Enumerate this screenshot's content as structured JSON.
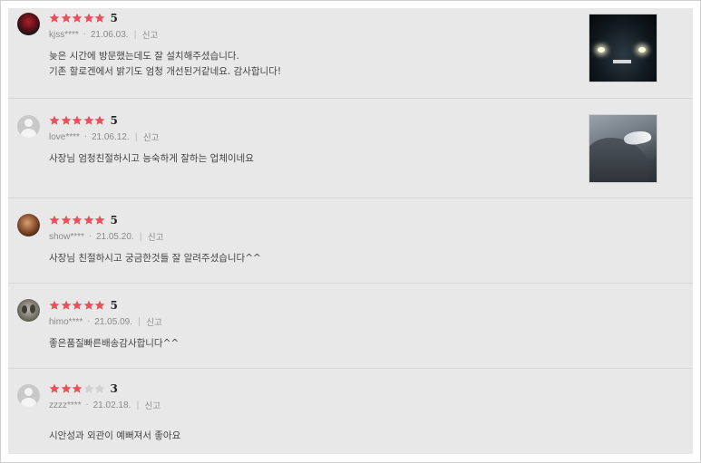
{
  "reviews": [
    {
      "avatar": "avatar-red-dark-photo",
      "stars": 5,
      "score": "5",
      "user": "kjss****",
      "date": "21.06.03.",
      "report": "신고",
      "lines": [
        "늦은 시간에 방문했는데도 잘 설치해주셨습니다.",
        "기존 할로겐에서 밝기도 엄청 개선된거같네요. 감사합니다!"
      ],
      "photo": "car-headlights-night-photo"
    },
    {
      "avatar": "default-user-icon",
      "stars": 5,
      "score": "5",
      "user": "love****",
      "date": "21.06.12.",
      "report": "신고",
      "lines": [
        "사장님 엄청친절하시고 능숙하게 잘하는 업체이네요"
      ],
      "photo": "car-headlight-closeup-photo"
    },
    {
      "avatar": "avatar-brown-photo",
      "stars": 5,
      "score": "5",
      "user": "show****",
      "date": "21.05.20.",
      "report": "신고",
      "lines": [
        "사장님 친절하시고 궁금한것들 잘 알려주셨습니다^^"
      ]
    },
    {
      "avatar": "avatar-people-photo",
      "stars": 5,
      "score": "5",
      "user": "himo****",
      "date": "21.05.09.",
      "report": "신고",
      "lines": [
        "좋은품질빠른배송감사합니다^^"
      ]
    },
    {
      "avatar": "default-user-icon",
      "stars": 3,
      "score": "3",
      "user": "zzzz****",
      "date": "21.02.18.",
      "report": "신고",
      "lines": [
        "시안성과 외관이 예뻐져서 좋아요"
      ]
    }
  ],
  "colors": {
    "star_filled": "#e8505b",
    "star_empty": "#d0d0d0",
    "panel_bg": "#e8e8e8"
  }
}
